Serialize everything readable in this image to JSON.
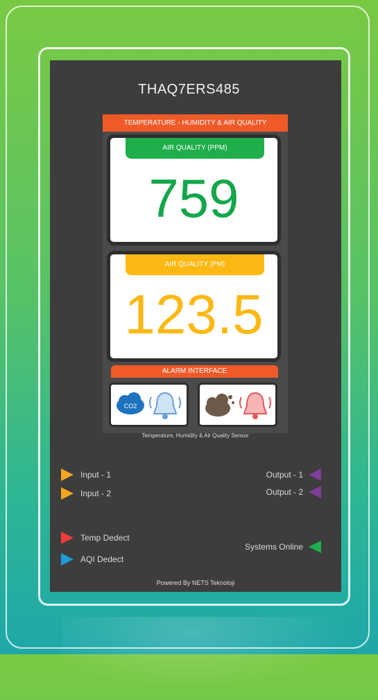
{
  "device": {
    "title": "THAQ7ERS485",
    "header": "TEMPERATURE - HUMIDITY & AIR QUALITY",
    "caption": "Temperature, Humidity & Air Quality Sensor"
  },
  "metrics": {
    "ppm": {
      "label": "AIR QUALITY (PPM)",
      "value": "759",
      "color": "#14a64b"
    },
    "pm": {
      "label": "AIR QUALITY (PM)",
      "value": "123.5",
      "color": "#fcb813"
    }
  },
  "alarm": {
    "header": "ALARM INTERFACE",
    "left_icons": [
      "co2-cloud-icon",
      "bell-icon"
    ],
    "right_icons": [
      "dust-icon",
      "bell-icon"
    ]
  },
  "inputs": [
    {
      "label": "Input - 1",
      "color": "#f6a623"
    },
    {
      "label": "Input - 2",
      "color": "#f6a623"
    }
  ],
  "outputs": [
    {
      "label": "Output - 1",
      "color": "#7f3f98"
    },
    {
      "label": "Output - 2",
      "color": "#7f3f98"
    }
  ],
  "detections": [
    {
      "label": "Temp Dedect",
      "color": "#ee3b3b"
    },
    {
      "label": "AQI Dedect",
      "color": "#1e9ad6"
    }
  ],
  "status": {
    "label": "Systems Online",
    "color": "#1fae4b"
  },
  "footer": "Powered By NETS Teknoloji"
}
